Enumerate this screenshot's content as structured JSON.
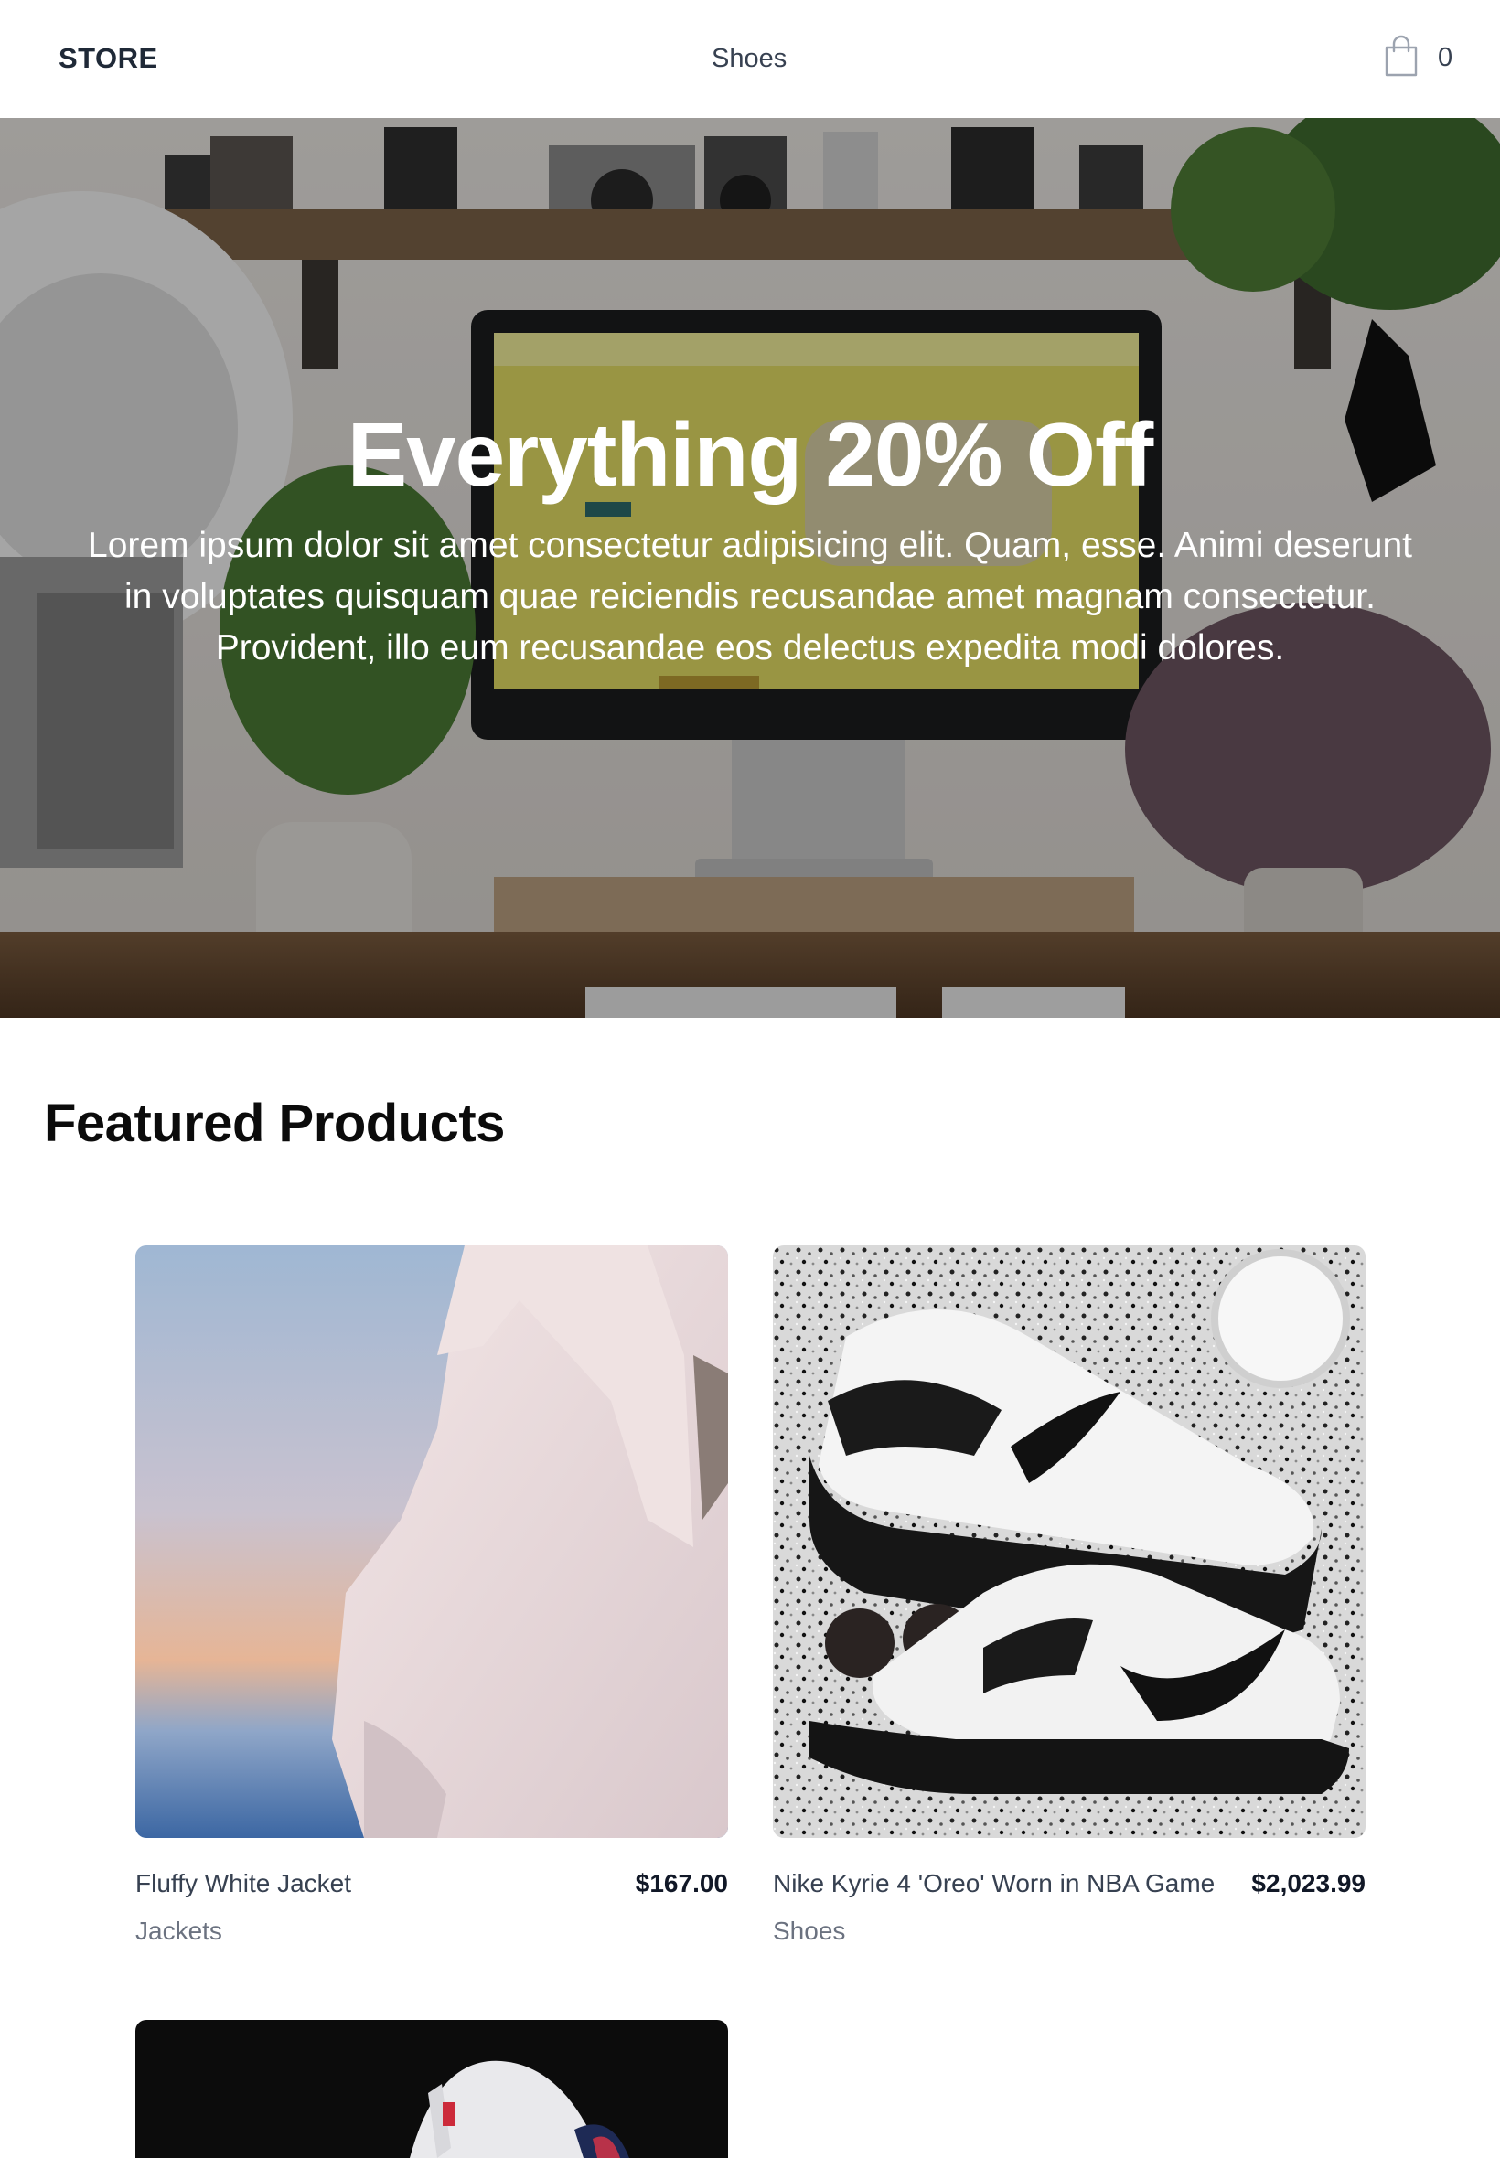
{
  "header": {
    "logo": "STORE",
    "nav_link": "Shoes",
    "cart_icon": "shopping-bag-icon",
    "cart_count": "0"
  },
  "hero": {
    "title": "Everything 20% Off",
    "text": "Lorem ipsum dolor sit amet consectetur adipisicing elit. Quam, esse. Animi deserunt in voluptates quisquam quae reiciendis recusandae amet magnam consectetur. Provident, illo eum recusandae eos delectus expedita modi dolores."
  },
  "featured": {
    "title": "Featured Products",
    "products": [
      {
        "name": "Fluffy White Jacket",
        "price": "$167.00",
        "category": "Jackets"
      },
      {
        "name": "Nike Kyrie 4 'Oreo' Worn in NBA Game",
        "price": "$2,023.99",
        "category": "Shoes"
      },
      {
        "name": "",
        "price": "",
        "category": ""
      }
    ]
  },
  "colors": {
    "text_dark": "#111827",
    "text_muted": "#6b7280",
    "background": "#ffffff"
  }
}
